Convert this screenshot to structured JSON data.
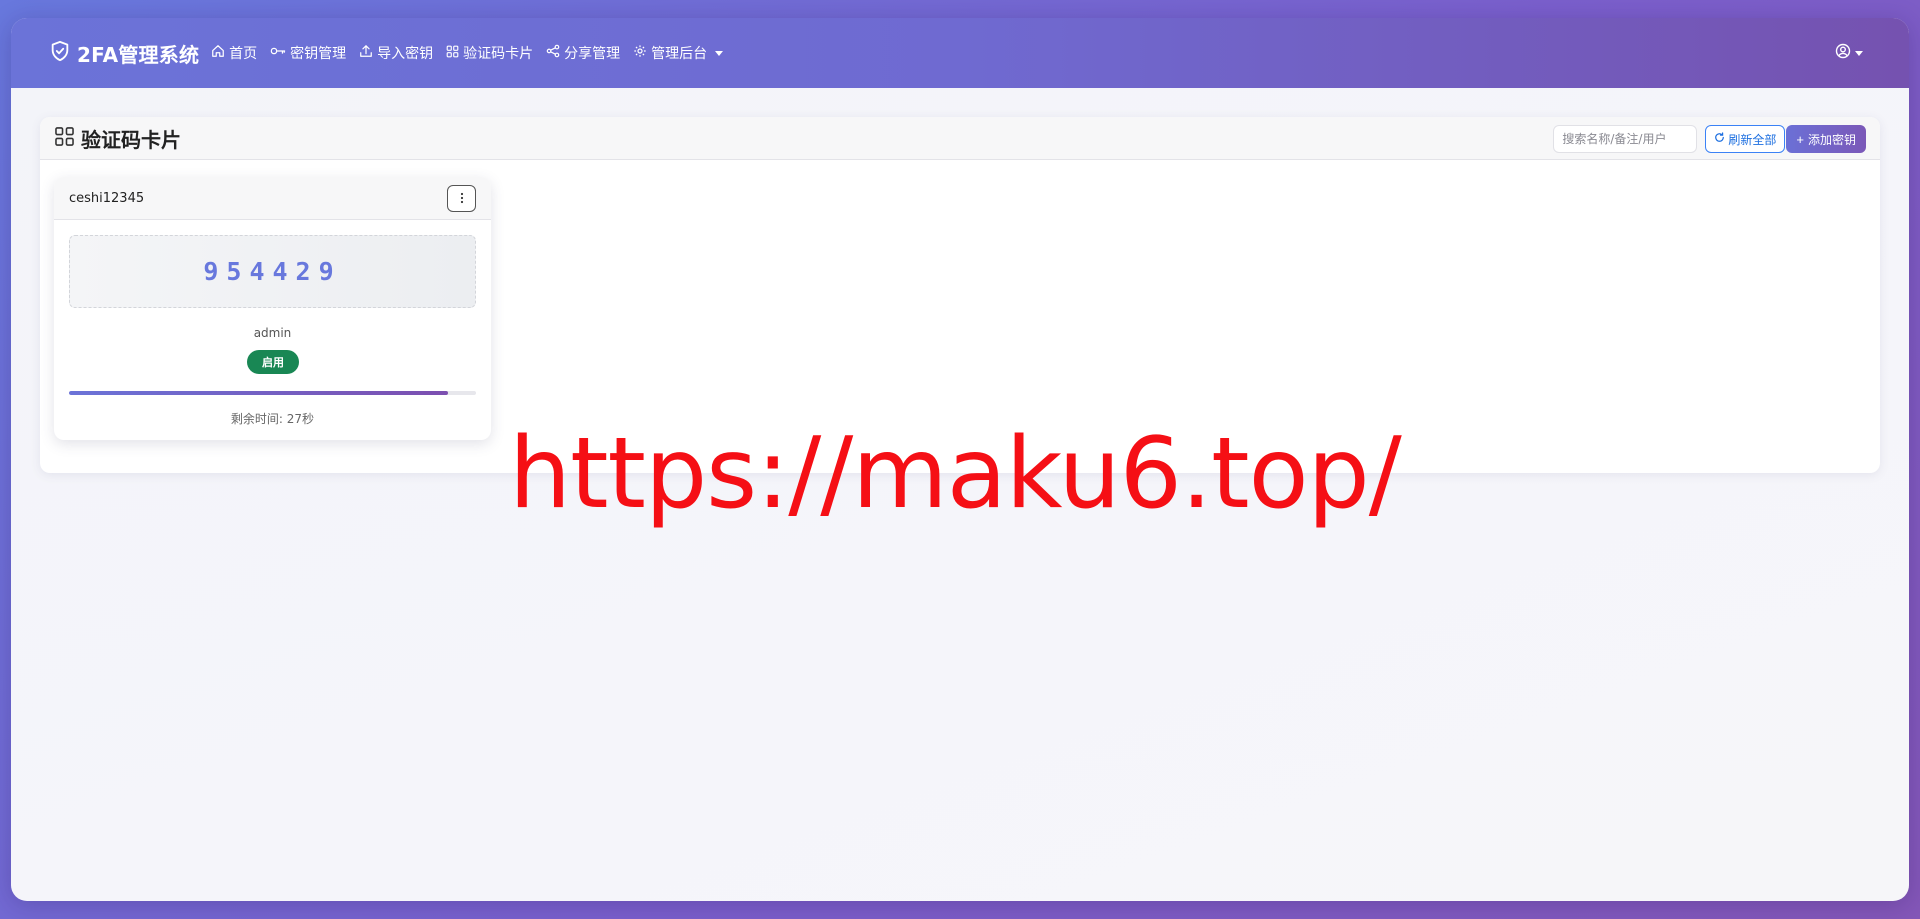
{
  "navbar": {
    "brand": "2FA管理系统",
    "items": [
      {
        "label": "首页",
        "icon": "home-icon"
      },
      {
        "label": "密钥管理",
        "icon": "key-icon"
      },
      {
        "label": "导入密钥",
        "icon": "upload-icon"
      },
      {
        "label": "验证码卡片",
        "icon": "grid-icon"
      },
      {
        "label": "分享管理",
        "icon": "share-icon"
      },
      {
        "label": "管理后台",
        "icon": "gear-icon",
        "dropdown": true
      }
    ],
    "user_icon": "user-circle-icon"
  },
  "panel": {
    "title": "验证码卡片",
    "search_placeholder": "搜索名称/备注/用户",
    "refresh_label": "刷新全部",
    "add_label": "添加密钥"
  },
  "cards": [
    {
      "name": "ceshi12345",
      "code": "954429",
      "account": "admin",
      "status": "启用",
      "status_color": "#198754",
      "remaining_text": "剩余时间: 27秒",
      "progress_fraction": 0.93
    }
  ],
  "watermark": "https://maku6.top/",
  "colors": {
    "accent": "#6b73d8",
    "accent_dark": "#7552b0",
    "code": "#6878dd",
    "watermark": "#f50f15"
  }
}
